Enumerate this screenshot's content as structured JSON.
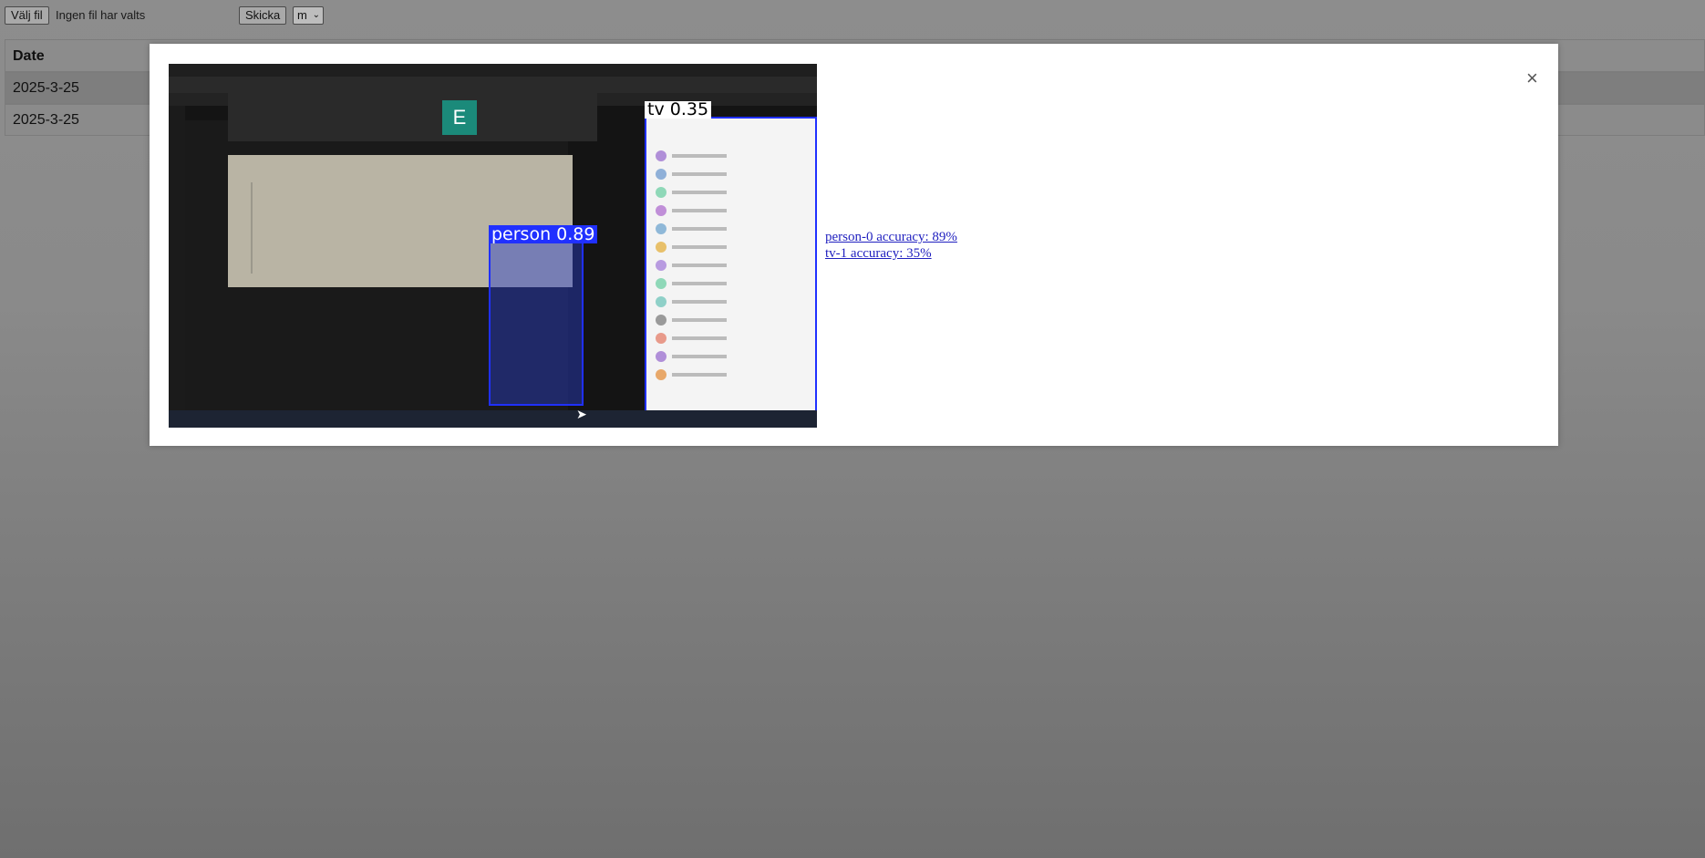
{
  "toolbar": {
    "choose_file_label": "Välj fil",
    "file_status": "Ingen fil har valts",
    "submit_label": "Skicka",
    "model_select_value": "m"
  },
  "table": {
    "header": "Date",
    "rows": [
      "2025-3-25",
      "2025-3-25"
    ]
  },
  "modal": {
    "close_symbol": "×",
    "detections": {
      "person_label": "person 0.89",
      "tv_label": "tv 0.35"
    },
    "embedded_avatar_letter": "E",
    "accuracy": [
      "person-0 accuracy: 89%",
      "tv-1 accuracy: 35%"
    ]
  },
  "colors": {
    "detection_box": "#2030ff",
    "accuracy_link": "#1f1fbf",
    "avatar_teal": "#1b8a7a"
  }
}
